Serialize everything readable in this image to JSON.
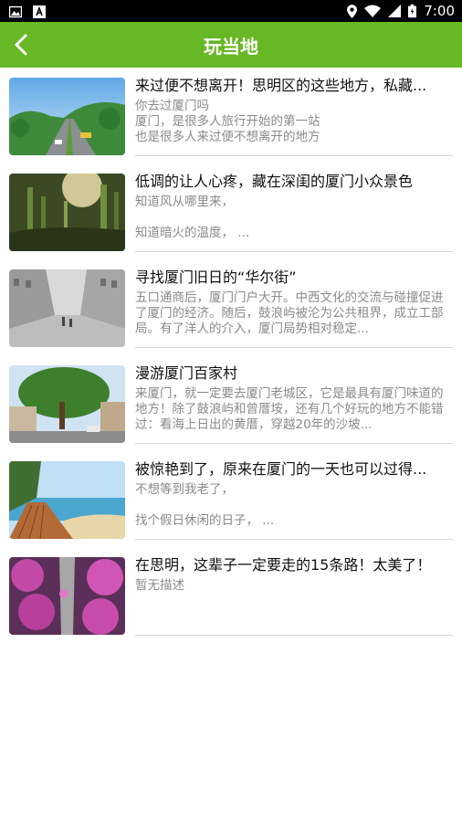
{
  "status_bar": {
    "time": "7:00"
  },
  "header": {
    "title": "玩当地"
  },
  "items": [
    {
      "title": "来过便不想离开！思明区的这些地方，私藏...",
      "desc": "你去过厦门吗\n厦门，是很多人旅行开始的第一站\n也是很多人来过便不想离开的地方"
    },
    {
      "title": "低调的让人心疼，藏在深闺的厦门小众景色",
      "desc": "知道风从哪里来，\n\n知道暗火的温度，  ..."
    },
    {
      "title": "寻找厦门旧日的“华尔街”",
      "desc": "五口通商后，厦门门户大开。中西文化的交流与碰撞促进了厦门的经济。随后，鼓浪屿被沦为公共租界，成立工部局。有了洋人的介入，厦门局势相对稳定..."
    },
    {
      "title": "漫游厦门百家村",
      "desc": "来厦门，就一定要去厦门老城区，它是最具有厦门味道的地方！除了鼓浪屿和曾厝垵，还有几个好玩的地方不能错过：看海上日出的黄厝，穿越20年的沙坡..."
    },
    {
      "title": "被惊艳到了，原来在厦门的一天也可以过得...",
      "desc": "不想等到我老了，\n\n找个假日休闲的日子，  ..."
    },
    {
      "title": "在思明，这辈子一定要走的15条路！太美了！",
      "desc": "暂无描述"
    }
  ]
}
